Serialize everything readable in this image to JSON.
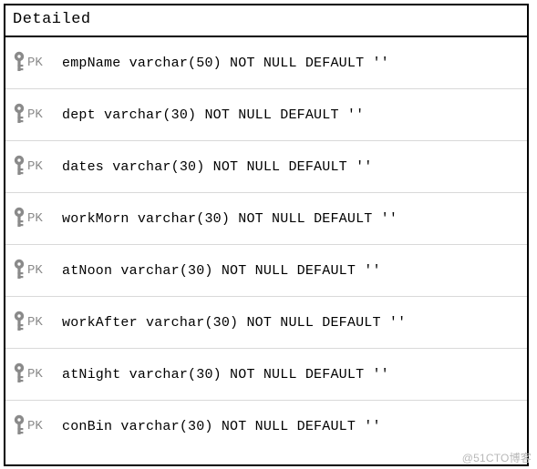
{
  "title": "Detailed",
  "pk_label": "PK",
  "columns": [
    {
      "name": "empName",
      "type": "varchar(50)",
      "constraints": "NOT NULL DEFAULT ''"
    },
    {
      "name": "dept",
      "type": "varchar(30)",
      "constraints": "NOT NULL DEFAULT ''"
    },
    {
      "name": "dates",
      "type": "varchar(30)",
      "constraints": "NOT NULL DEFAULT ''"
    },
    {
      "name": "workMorn",
      "type": "varchar(30)",
      "constraints": "NOT NULL DEFAULT ''"
    },
    {
      "name": "atNoon",
      "type": "varchar(30)",
      "constraints": "NOT NULL DEFAULT ''"
    },
    {
      "name": "workAfter",
      "type": "varchar(30)",
      "constraints": "NOT NULL DEFAULT ''"
    },
    {
      "name": "atNight",
      "type": "varchar(30)",
      "constraints": "NOT NULL DEFAULT ''"
    },
    {
      "name": "conBin",
      "type": "varchar(30)",
      "constraints": "NOT NULL DEFAULT ''"
    }
  ],
  "watermark": "@51CTO博客"
}
